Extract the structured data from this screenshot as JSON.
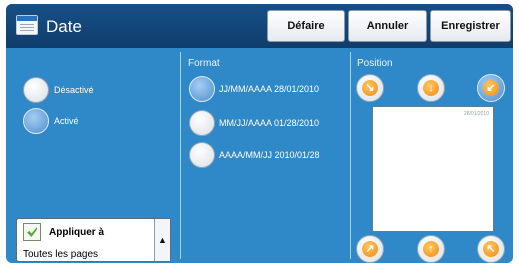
{
  "header": {
    "title": "Date",
    "undo_label": "Défaire",
    "cancel_label": "Annuler",
    "save_label": "Enregistrer"
  },
  "state": {
    "options": [
      {
        "label": "Désactivé",
        "selected": false
      },
      {
        "label": "Activé",
        "selected": true
      }
    ]
  },
  "format": {
    "heading": "Format",
    "options": [
      {
        "label": "JJ/MM/AAAA 28/01/2010",
        "selected": true
      },
      {
        "label": "MM/JJ/AAAA 01/28/2010",
        "selected": false
      },
      {
        "label": "AAAA/MM/JJ 2010/01/28",
        "selected": false
      }
    ]
  },
  "position": {
    "heading": "Position",
    "preview_date": "28/01/2010",
    "buttons": [
      {
        "name": "top-left",
        "icon": "arrow-top-left-icon",
        "selected": false
      },
      {
        "name": "top-center",
        "icon": "arrow-up-icon",
        "selected": false
      },
      {
        "name": "top-right",
        "icon": "arrow-top-right-icon",
        "selected": true
      },
      {
        "name": "bottom-left",
        "icon": "arrow-bottom-left-icon",
        "selected": false
      },
      {
        "name": "bottom-center",
        "icon": "arrow-down-icon",
        "selected": false
      },
      {
        "name": "bottom-right",
        "icon": "arrow-bottom-right-icon",
        "selected": false
      }
    ]
  },
  "apply": {
    "title": "Appliquer à",
    "value": "Toutes les pages"
  },
  "colors": {
    "panel": "#2f88c7",
    "header": "#174f86",
    "arrow": "#f08a10"
  }
}
